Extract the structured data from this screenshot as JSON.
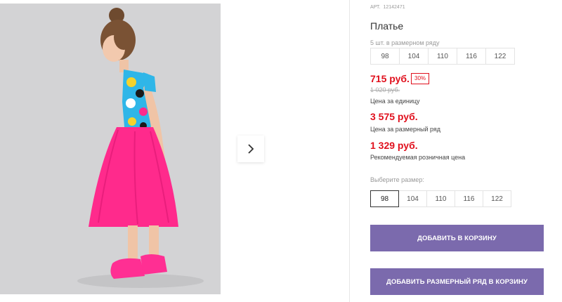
{
  "gallery": {
    "next_icon": "chevron-right-icon"
  },
  "product": {
    "sku_label": "АРТ.",
    "sku_value": "12142471",
    "title": "Платье",
    "row_note": "5 шт. в размерном ряду",
    "row_sizes": [
      "98",
      "104",
      "110",
      "116",
      "122"
    ],
    "unit_price": "715 руб.",
    "discount": "30%",
    "old_price": "1 020 руб.",
    "unit_price_caption": "Цена за единицу",
    "row_price": "3 575 руб.",
    "row_price_caption": "Цена за размерный ряд",
    "retail_price": "1 329 руб.",
    "retail_price_caption": "Рекомендуемая розничная цена",
    "size_select_label": "Выберите размер:",
    "size_options": [
      "98",
      "104",
      "110",
      "116",
      "122"
    ],
    "selected_size": "98",
    "add_to_cart": "Добавить в корзину",
    "add_row_to_cart": "Добавить размерный ряд в корзину"
  },
  "colors": {
    "price_red": "#e0101d",
    "button_purple": "#7b6aad",
    "photo_background": "#d3d3d5",
    "dress_pink": "#ff2a8c"
  }
}
